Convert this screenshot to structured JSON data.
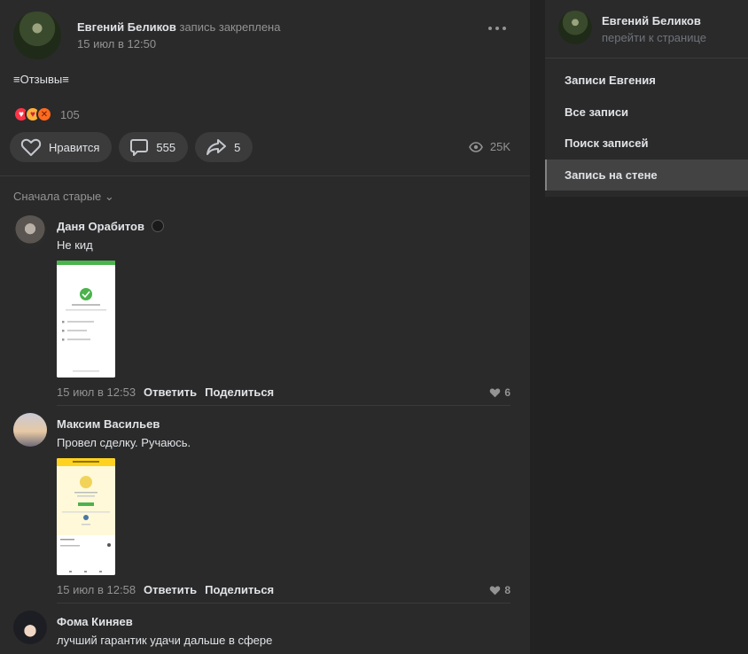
{
  "post": {
    "author_name": "Евгений Беликов",
    "author_action": "запись закреплена",
    "date": "15 июл в 12:50",
    "text": "≡Отзывы≡",
    "reactions_count": "105",
    "likes_label": "Нравится",
    "comments_count": "555",
    "shares_count": "5",
    "views": "25K"
  },
  "comments": {
    "sort_label": "Сначала старые",
    "items": [
      {
        "name": "Даня Орабитов",
        "text": "Не кид",
        "date": "15 июл в 12:53",
        "reply": "Ответить",
        "share": "Поделиться",
        "likes": "6"
      },
      {
        "name": "Максим Васильев",
        "text": "Провел сделку. Ручаюсь.",
        "date": "15 июл в 12:58",
        "reply": "Ответить",
        "share": "Поделиться",
        "likes": "8"
      },
      {
        "name": "Фома Киняев",
        "text": "лучший гарантик удачи дальше в сфере"
      }
    ]
  },
  "sidebar": {
    "name": "Евгений Беликов",
    "subtitle": "перейти к странице",
    "items": [
      {
        "label": "Записи Евгения"
      },
      {
        "label": "Все записи"
      },
      {
        "label": "Поиск записей"
      },
      {
        "label": "Запись на стене"
      }
    ]
  },
  "colors": {
    "page_bg": "#222222",
    "card_bg": "#2a2a2b",
    "button_bg": "#3b3b3c",
    "text_primary": "#e1e3e6",
    "text_secondary": "#939393",
    "active_item_bg": "#434344"
  }
}
